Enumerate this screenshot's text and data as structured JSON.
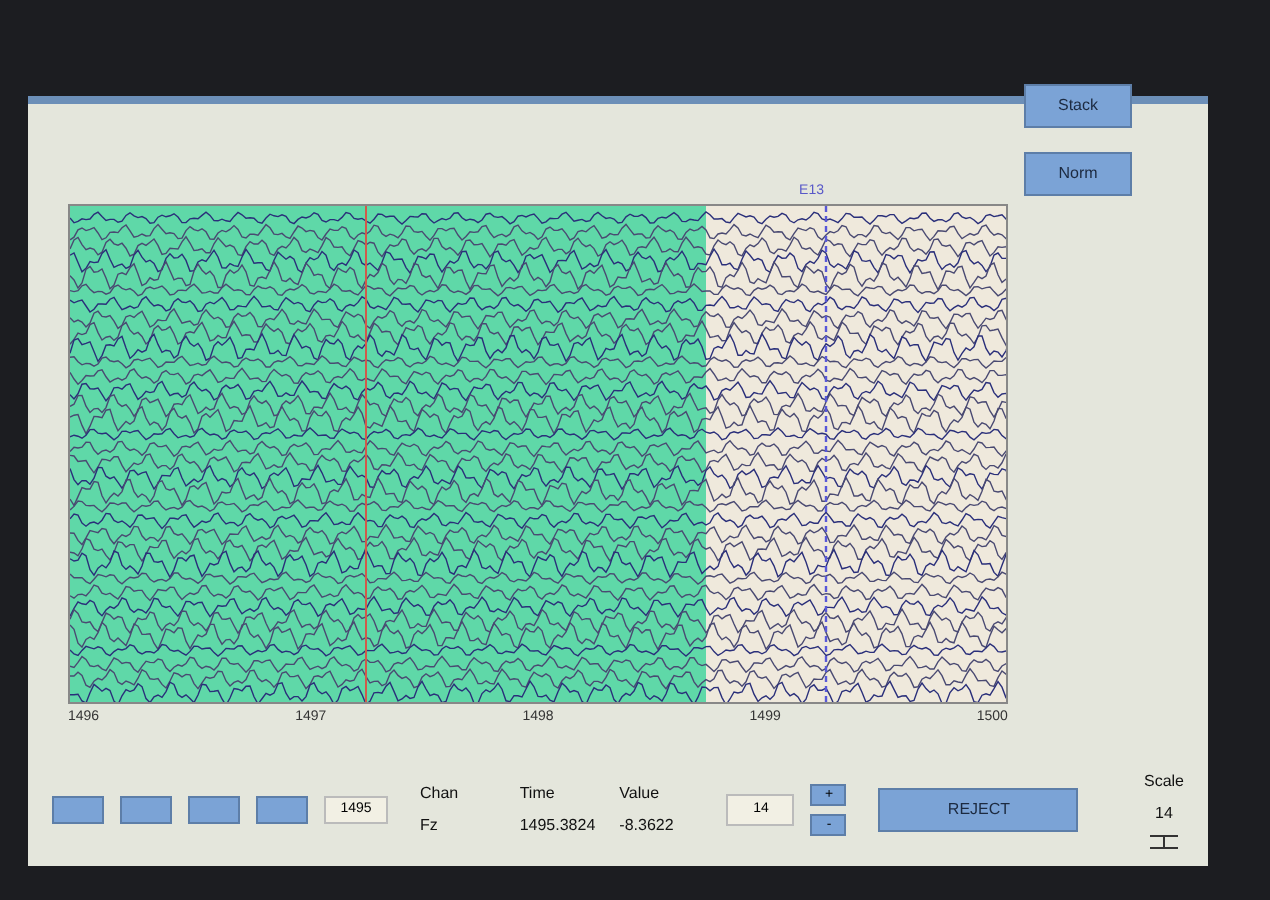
{
  "side_buttons": [
    "Stack",
    "Norm"
  ],
  "plot": {
    "xticks": [
      "1496",
      "1497",
      "1498",
      "1499",
      "1500"
    ],
    "marker_label": "E13"
  },
  "nav_field": {
    "value": "1495"
  },
  "readout": {
    "headers": [
      "Chan",
      "Time",
      "Value"
    ],
    "values": [
      "Fz",
      "1495.3824",
      "-8.3622"
    ]
  },
  "gain_field": {
    "value": "14"
  },
  "gain_buttons": [
    "+",
    "-"
  ],
  "reject_button": "REJECT",
  "scale": {
    "label": "Scale",
    "value": "14"
  }
}
